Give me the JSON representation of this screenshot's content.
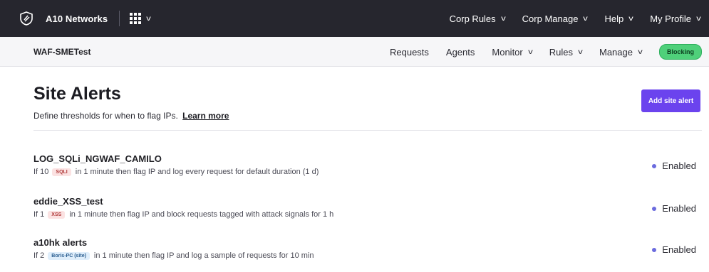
{
  "topnav": {
    "brand": "A10 Networks",
    "menu": [
      {
        "label": "Corp Rules"
      },
      {
        "label": "Corp Manage"
      },
      {
        "label": "Help"
      },
      {
        "label": "My Profile"
      }
    ]
  },
  "subnav": {
    "site_name": "WAF-SMETest",
    "menu": [
      {
        "label": "Requests",
        "dropdown": false
      },
      {
        "label": "Agents",
        "dropdown": false
      },
      {
        "label": "Monitor",
        "dropdown": true
      },
      {
        "label": "Rules",
        "dropdown": true
      },
      {
        "label": "Manage",
        "dropdown": true
      }
    ],
    "mode_badge": "Blocking"
  },
  "page": {
    "title": "Site Alerts",
    "subtitle": "Define thresholds for when to flag IPs.",
    "learn_more": "Learn more",
    "add_button": "Add site alert"
  },
  "alerts": [
    {
      "name": "LOG_SQLi_NGWAF_CAMILO",
      "prefix": "If 10",
      "tag": "SQLI",
      "tag_color": "red",
      "suffix": "in 1 minute then flag IP and log every request for default duration (1 d)",
      "status": "Enabled"
    },
    {
      "name": "eddie_XSS_test",
      "prefix": "If 1",
      "tag": "XSS",
      "tag_color": "red",
      "suffix": "in 1 minute then flag IP and block requests tagged with attack signals for 1 h",
      "status": "Enabled"
    },
    {
      "name": "a10hk alerts",
      "prefix": "If 2",
      "tag": "Boris-PC (site)",
      "tag_color": "blue",
      "suffix": "in 1 minute then flag IP and log a sample of requests for 10 min",
      "status": "Enabled"
    }
  ],
  "colors": {
    "topnav_bg": "#26262e",
    "accent": "#6b43ee",
    "badge_green": "#4fd07a",
    "status_dot": "#6b6bde"
  }
}
